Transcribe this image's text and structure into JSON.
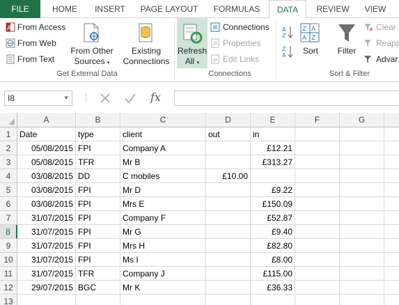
{
  "tabs": [
    "FILE",
    "HOME",
    "INSERT",
    "PAGE LAYOUT",
    "FORMULAS",
    "DATA",
    "REVIEW",
    "VIEW"
  ],
  "active_tab": "DATA",
  "ribbon": {
    "get_external": {
      "from_access": "From Access",
      "from_web": "From Web",
      "from_text": "From Text",
      "from_other_line1": "From Other",
      "from_other_line2": "Sources",
      "existing_line1": "Existing",
      "existing_line2": "Connections",
      "label": "Get External Data"
    },
    "connections": {
      "refresh_line1": "Refresh",
      "refresh_line2": "All",
      "connections": "Connections",
      "properties": "Properties",
      "edit_links": "Edit Links",
      "label": "Connections"
    },
    "sort_filter": {
      "sort": "Sort",
      "filter": "Filter",
      "clear": "Clear",
      "reapply": "Reapp",
      "advanced": "Advar",
      "label": "Sort & Filter"
    }
  },
  "formula_bar": {
    "name_box": "I8",
    "formula": ""
  },
  "sheet": {
    "columns": [
      "A",
      "B",
      "C",
      "D",
      "E",
      "F",
      "G"
    ],
    "selected_row": 8,
    "rows": [
      {
        "num": "1",
        "date": "Date",
        "type": "type",
        "client": "client",
        "out": "out",
        "in": "in"
      },
      {
        "num": "2",
        "date": "05/08/2015",
        "type": "FPI",
        "client": "Company A",
        "out": "",
        "in": "£12.21"
      },
      {
        "num": "3",
        "date": "05/08/2015",
        "type": "TFR",
        "client": "Mr B",
        "out": "",
        "in": "£313.27"
      },
      {
        "num": "4",
        "date": "03/08/2015",
        "type": "DD",
        "client": "C mobiles",
        "out": "£10.00",
        "in": ""
      },
      {
        "num": "5",
        "date": "03/08/2015",
        "type": "FPI",
        "client": "Mr D",
        "out": "",
        "in": "£9.22"
      },
      {
        "num": "6",
        "date": "03/08/2015",
        "type": "FPI",
        "client": "Mrs E",
        "out": "",
        "in": "£150.09"
      },
      {
        "num": "7",
        "date": "31/07/2015",
        "type": "FPI",
        "client": "Company F",
        "out": "",
        "in": "£52.87"
      },
      {
        "num": "8",
        "date": "31/07/2015",
        "type": "FPI",
        "client": "Mr G",
        "out": "",
        "in": "£9.40"
      },
      {
        "num": "9",
        "date": "31/07/2015",
        "type": "FPI",
        "client": "Mrs H",
        "out": "",
        "in": "£82.80"
      },
      {
        "num": "10",
        "date": "31/07/2015",
        "type": "FPI",
        "client": "Ms I",
        "out": "",
        "in": "£8.00"
      },
      {
        "num": "11",
        "date": "31/07/2015",
        "type": "TFR",
        "client": "Company J",
        "out": "",
        "in": "£115.00"
      },
      {
        "num": "12",
        "date": "29/07/2015",
        "type": "BGC",
        "client": "Mr K",
        "out": "",
        "in": "£36.33"
      },
      {
        "num": "13",
        "date": "",
        "type": "",
        "client": "",
        "out": "",
        "in": ""
      }
    ]
  },
  "colors": {
    "accent": "#217346",
    "header_bg": "#f3f3f3",
    "gridline": "#d9d9d9"
  }
}
